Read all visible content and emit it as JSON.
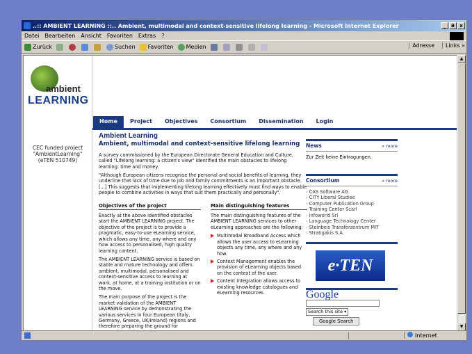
{
  "window": {
    "title": "..:: AMBIENT LEARNING ::.. Ambient, multimodal and context-sensitive lifelong learning - Microsoft Internet Explorer",
    "controls": [
      "_",
      "й",
      "x"
    ]
  },
  "menubar": [
    "Datei",
    "Bearbeiten",
    "Ansicht",
    "Favoriten",
    "Extras",
    "?"
  ],
  "toolbar": {
    "back": "Zurück",
    "search": "Suchen",
    "favorites": "Favoriten",
    "media": "Medien",
    "address_label": "Adresse",
    "links_label": "Links »"
  },
  "status": {
    "zone_label": "Internet"
  },
  "page": {
    "logo_top": "ambient",
    "logo_bottom": "LEARNING",
    "nav": [
      "Home",
      "Project",
      "Objectives",
      "Consortium",
      "Dissemination",
      "Login"
    ],
    "nav_active": "Home",
    "leftnote": "CEC funded project \"AmbientLearning\" (eTEN 510749)",
    "title": "Ambient Learning",
    "subtitle": "Ambient, multimodal and context-sensitive lifelong learning",
    "intro1": "A survey commissioned by the European Directorate General Education and Culture, called \"Lifelong learning: a citizen's view\" identified the main obstacles to lifelong learning: time and money.",
    "intro2": "\"Although European citizens recognise the personal and social benefits of learning, they underline that lack of time due to job and family commitments is an important obstacle. [...] This suggests that implementing lifelong learning effectively must find ways to enable people to combine activities in ways that suit them practically and personally\".",
    "obj_head": "Objectives of the project",
    "obj_p1": "Exactly at the above identified obstacles start the AMBIENT LEARNING project. The objective of the project is to provide a pragmatic, easy-to-use eLearning service, which allows any time, any where and any how access to personalised, high quality learning content.",
    "obj_p2": "The AMBIENT LEARNING service is based on stable and mature technology and offers ambient, multimodal, personalised and context-sensitive access to learning at work, at home, at a training institution or on the move.",
    "obj_p3": "The main purpose of the project is the market validation of the AMBIENT LEARNING service by demonstrating the various services in four European (Italy, Germany, Greece, UK/Ireland) regions and therefore preparing the ground for successful market deployment.",
    "feat_head": "Main distinguishing features",
    "feat_intro": "The main distinguishing features of the AMBIENT LEARNING services to other eLearning approaches are the following:",
    "features": [
      "Multimodal Broadband Access which allows the user access to eLearning objects any time, any where and any how.",
      "Context Management enables the provision of eLearning objects based on the context of the user.",
      "Content Integration allows access to existing knowledge catalogues and eLearning resources."
    ],
    "news_head": "News",
    "news_more": "» more",
    "news_text": "Zur Zeit keine Eintragungen.",
    "consortium_head": "Consortium",
    "consortium_more": "» more",
    "consortium": [
      "CAS Software AG",
      "CITY Liberal Studies",
      "Computer Publication Group",
      "Training Center Scarl",
      "Infoworld Srl",
      "Language Technology Center",
      "Steinbeis Transferzentrum MIT",
      "Stratigakis S.A."
    ],
    "eten_logo": "e·TEN",
    "google_logo": "Google",
    "google_select": "Search this site",
    "google_button": "Google Search"
  }
}
